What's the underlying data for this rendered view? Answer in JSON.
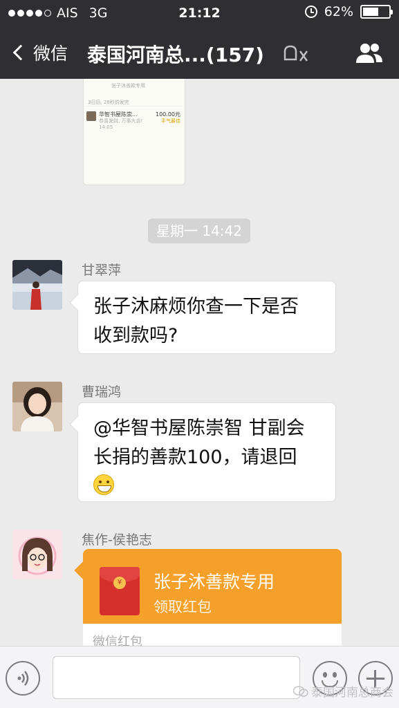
{
  "status_bar": {
    "carrier": "AIS",
    "network": "3G",
    "time": "21:12",
    "battery": "62%",
    "battery_level": 0.62,
    "signal_bars": 4
  },
  "nav": {
    "back_label": "微信",
    "title": "泰国河南总...(157)"
  },
  "embedded_screenshot": {
    "caption": "张子沐善款专用",
    "meta": "3日后, 28秒前发完",
    "item_name": "华智书屋陈崇...",
    "item_sub": "恭喜发财, 万事大吉!",
    "item_time": "14:05",
    "item_amount": "100.00元",
    "item_status": "手气最佳"
  },
  "timestamp": "星期一 14:42",
  "messages": [
    {
      "sender": "甘翠萍",
      "lines": [
        "张子沐麻烦你查一下是否",
        "收到款吗?"
      ]
    },
    {
      "sender": "曹瑞鸿",
      "lines": [
        "@华智书屋陈崇智 甘副会",
        "长捐的善款100，请退回"
      ]
    },
    {
      "sender": "焦作-侯艳志",
      "red_packet": {
        "title": "张子沐善款专用",
        "subtitle": "领取红包",
        "footer": "微信红包",
        "coin_symbol": "¥"
      }
    }
  ],
  "watermark": "泰国河南总商会",
  "icons": {
    "back": "chevron-left-icon",
    "mute": "muted-bell-icon",
    "group": "group-members-icon",
    "voice": "voice-icon",
    "emoji": "emoji-icon",
    "more": "plus-icon"
  }
}
